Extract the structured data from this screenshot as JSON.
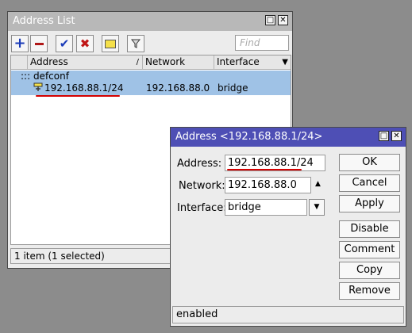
{
  "address_list": {
    "title": "Address List",
    "toolbar": {
      "add_icon": "plus-icon",
      "remove_icon": "minus-icon",
      "enable_icon": "check-icon",
      "disable_icon": "x-icon",
      "comment_icon": "note-icon",
      "filter_icon": "filter-icon"
    },
    "find_placeholder": "Find",
    "columns": [
      "Address",
      "Network",
      "Interface"
    ],
    "group_label": "::: defconf",
    "rows": [
      {
        "address": "192.168.88.1/24",
        "network": "192.168.88.0",
        "interface": "bridge"
      }
    ],
    "status": "1 item (1 selected)"
  },
  "address_dialog": {
    "title": "Address <192.168.88.1/24>",
    "fields": {
      "address_label": "Address:",
      "address_value": "192.168.88.1/24",
      "network_label": "Network:",
      "network_value": "192.168.88.0",
      "interface_label": "Interface:",
      "interface_value": "bridge"
    },
    "buttons": {
      "ok": "OK",
      "cancel": "Cancel",
      "apply": "Apply",
      "disable": "Disable",
      "comment": "Comment",
      "copy": "Copy",
      "remove": "Remove"
    },
    "status": "enabled"
  },
  "colors": {
    "selection": "#9fc2e6",
    "dialog_titlebar": "#4e4fb5",
    "annotation_underline": "#d40000"
  }
}
